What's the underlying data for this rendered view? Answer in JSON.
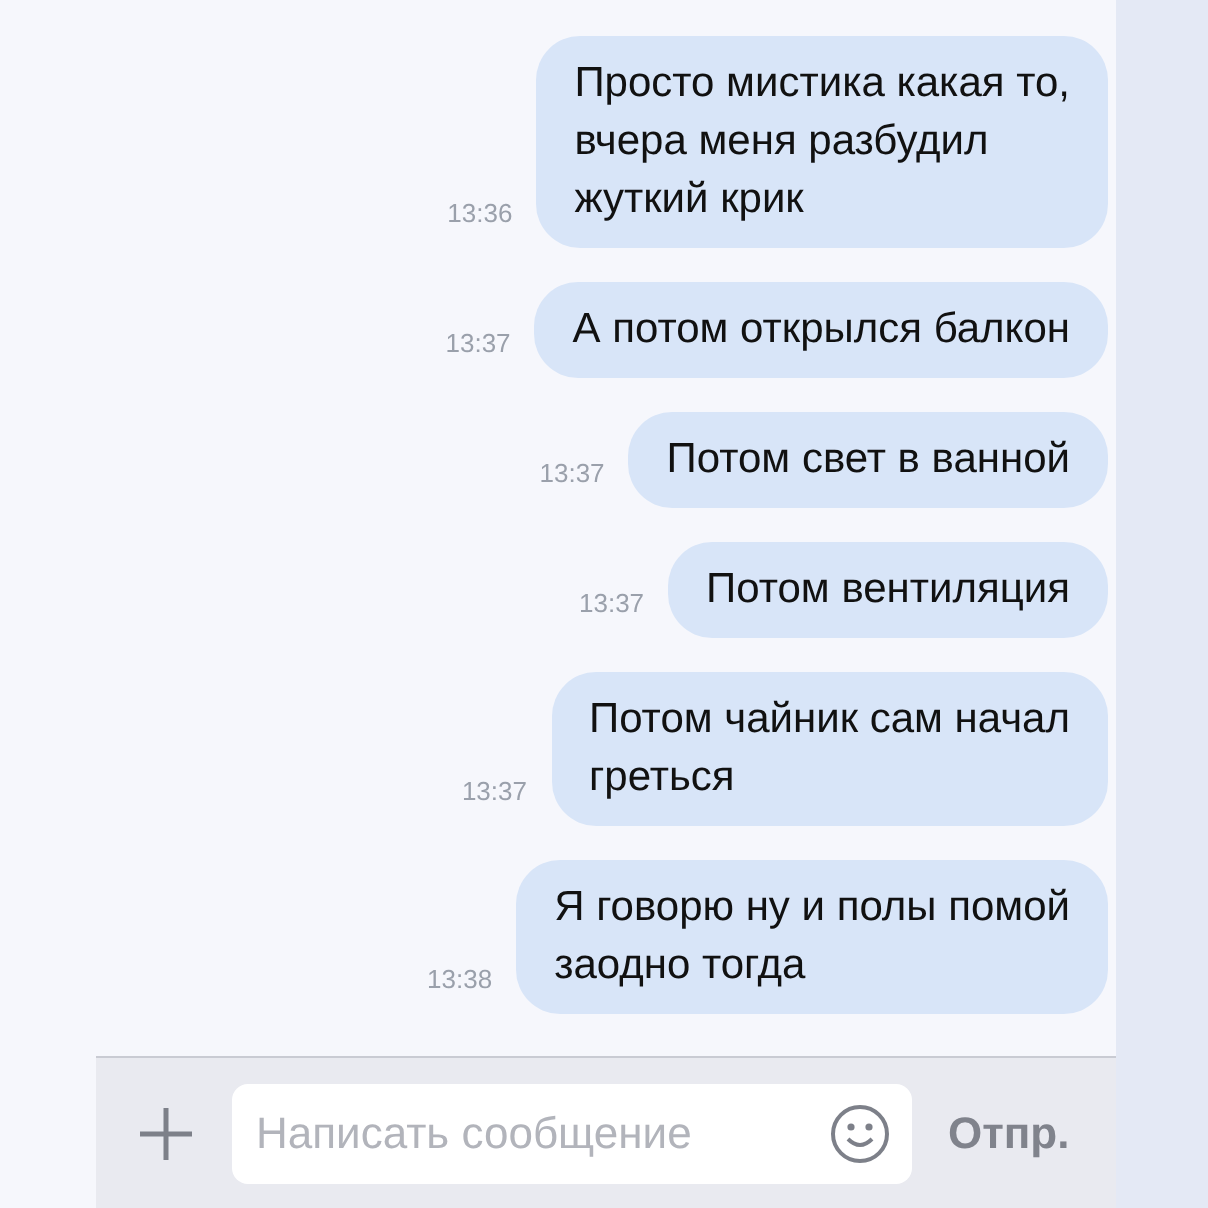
{
  "messages": [
    {
      "text": "Просто мистика какая то,\nвчера меня разбудил\nжуткий крик",
      "time": "13:36"
    },
    {
      "text": "А потом открылся балкон",
      "time": "13:37"
    },
    {
      "text": "Потом свет в ванной",
      "time": "13:37"
    },
    {
      "text": "Потом вентиляция",
      "time": "13:37"
    },
    {
      "text": "Потом чайник сам начал\nгреться",
      "time": "13:37"
    },
    {
      "text": "Я говорю ну и полы помой\nзаодно тогда",
      "time": "13:38"
    }
  ],
  "composer": {
    "placeholder": "Написать сообщение",
    "send": "Отпр."
  }
}
